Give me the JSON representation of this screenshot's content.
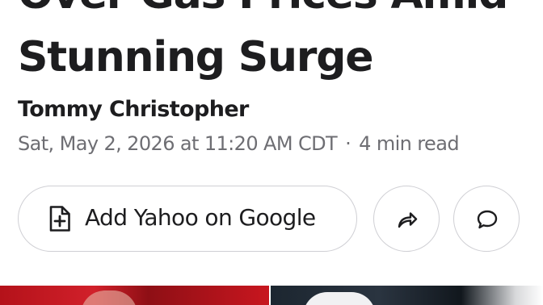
{
  "article": {
    "headline_line1": "Over Gas Prices Amid",
    "headline_line2": "Stunning Surge",
    "author": "Tommy Christopher",
    "date": "Sat, May 2, 2026 at 11:20 AM CDT",
    "separator": "·",
    "read_time": "4 min read"
  },
  "actions": {
    "add_source_label": "Add Yahoo on Google",
    "add_source_icon": "document-plus-icon",
    "share_icon": "share-arrow-icon",
    "comment_icon": "comment-bubble-icon"
  },
  "colors": {
    "text": "#1d1d1f",
    "meta": "#6e6e73",
    "border": "#cfcfd4"
  }
}
